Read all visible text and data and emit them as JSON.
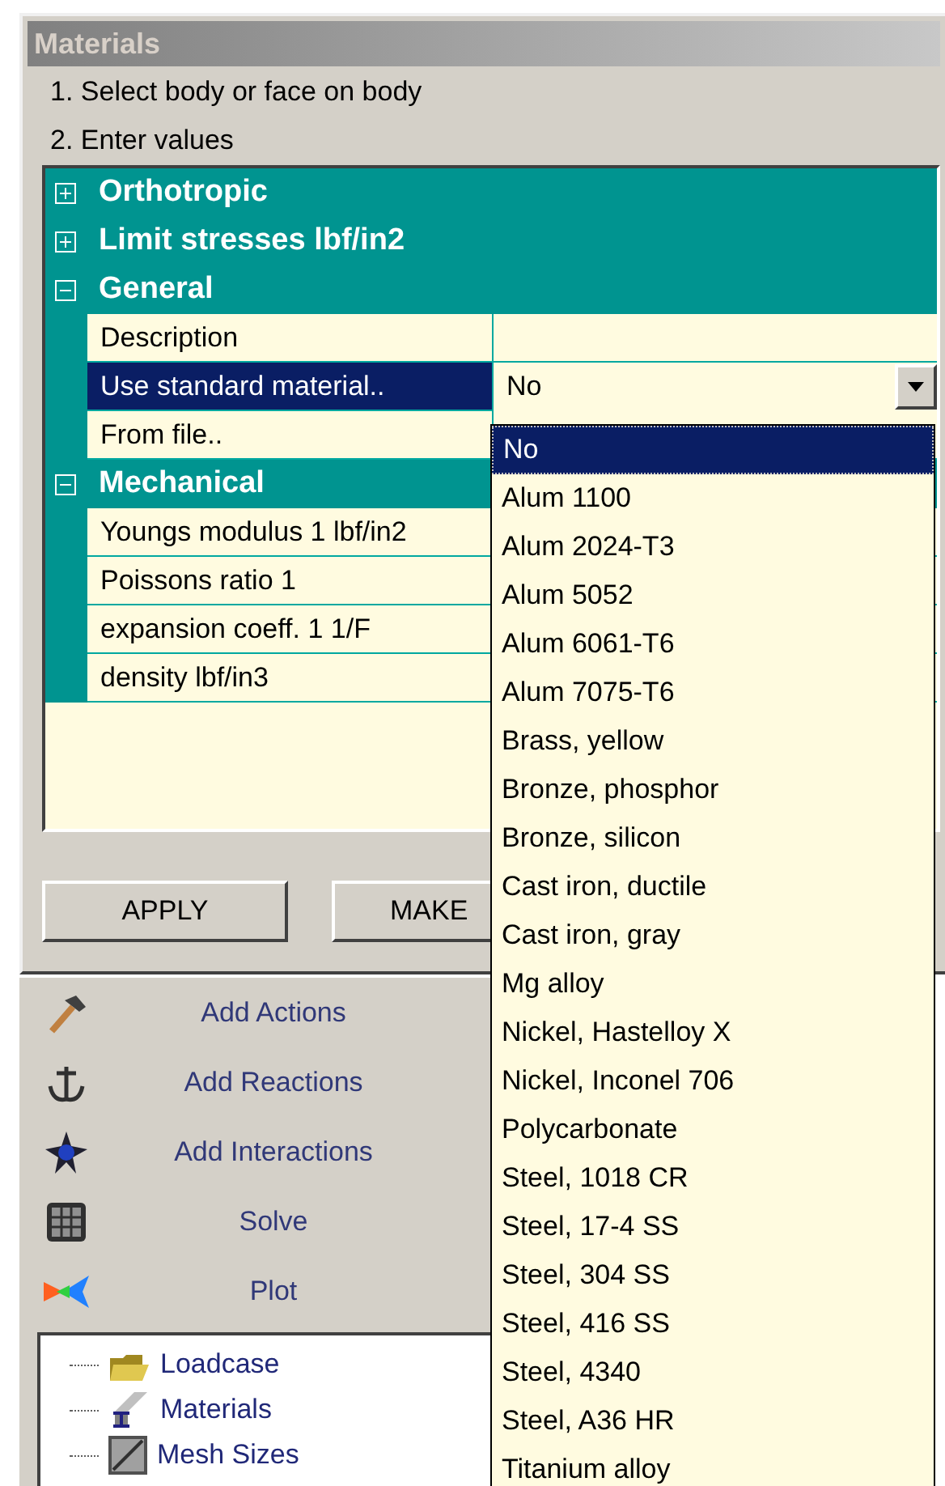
{
  "window": {
    "title": "Materials"
  },
  "instructions": [
    "1. Select body or face on body",
    "2. Enter values"
  ],
  "categories": [
    {
      "label": "Orthotropic",
      "expanded": false
    },
    {
      "label": "Limit stresses lbf/in2",
      "expanded": false
    },
    {
      "label": "General",
      "expanded": true,
      "properties": [
        {
          "label": "Description",
          "selected": false,
          "kind": "text"
        },
        {
          "label": "Use standard material..",
          "selected": true,
          "kind": "combo",
          "value": "No"
        },
        {
          "label": "From file..",
          "selected": false,
          "kind": "text"
        }
      ]
    },
    {
      "label": "Mechanical",
      "expanded": true,
      "properties": [
        {
          "label": "Youngs modulus 1 lbf/in2",
          "selected": false,
          "kind": "text"
        },
        {
          "label": "Poissons ratio 1",
          "selected": false,
          "kind": "text"
        },
        {
          "label": "expansion coeff. 1 1/F",
          "selected": false,
          "kind": "text"
        },
        {
          "label": "density lbf/in3",
          "selected": false,
          "kind": "text"
        }
      ]
    }
  ],
  "dropdown_options": [
    {
      "label": "No",
      "selected": true
    },
    {
      "label": "Alum 1100",
      "selected": false
    },
    {
      "label": "Alum 2024-T3",
      "selected": false
    },
    {
      "label": "Alum 5052",
      "selected": false
    },
    {
      "label": "Alum 6061-T6",
      "selected": false
    },
    {
      "label": "Alum 7075-T6",
      "selected": false
    },
    {
      "label": "Brass, yellow",
      "selected": false
    },
    {
      "label": "Bronze, phosphor",
      "selected": false
    },
    {
      "label": "Bronze, silicon",
      "selected": false
    },
    {
      "label": "Cast iron, ductile",
      "selected": false
    },
    {
      "label": "Cast iron, gray",
      "selected": false
    },
    {
      "label": "Mg alloy",
      "selected": false
    },
    {
      "label": "Nickel, Hastelloy X",
      "selected": false
    },
    {
      "label": "Nickel, Inconel 706",
      "selected": false
    },
    {
      "label": "Polycarbonate",
      "selected": false
    },
    {
      "label": "Steel, 1018 CR",
      "selected": false
    },
    {
      "label": "Steel, 17-4 SS",
      "selected": false
    },
    {
      "label": "Steel, 304 SS",
      "selected": false
    },
    {
      "label": "Steel, 416 SS",
      "selected": false
    },
    {
      "label": "Steel, 4340",
      "selected": false
    },
    {
      "label": "Steel, A36 HR",
      "selected": false
    },
    {
      "label": "Titanium alloy",
      "selected": false
    }
  ],
  "buttons": [
    "APPLY",
    "MAKE"
  ],
  "tools": [
    {
      "label": "Add Actions"
    },
    {
      "label": "Add Reactions"
    },
    {
      "label": "Add Interactions"
    },
    {
      "label": "Solve"
    },
    {
      "label": "Plot"
    }
  ],
  "tree": [
    {
      "label": "Loadcase"
    },
    {
      "label": "Materials"
    },
    {
      "label": "Mesh Sizes"
    }
  ]
}
